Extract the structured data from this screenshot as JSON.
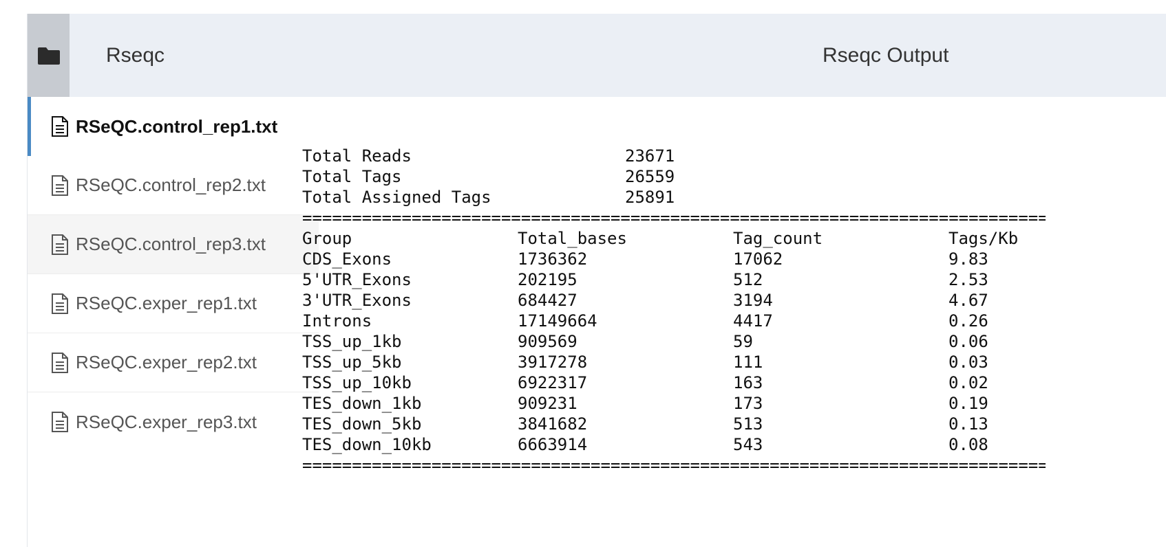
{
  "header": {
    "title": "Rseqc",
    "output_title": "Rseqc Output"
  },
  "files": [
    {
      "name": "RSeQC.control_rep1.txt"
    },
    {
      "name": "RSeQC.control_rep2.txt"
    },
    {
      "name": "RSeQC.control_rep3.txt"
    },
    {
      "name": "RSeQC.exper_rep1.txt"
    },
    {
      "name": "RSeQC.exper_rep2.txt"
    },
    {
      "name": "RSeQC.exper_rep3.txt"
    }
  ],
  "colors": {
    "accent": "#4a8ac4",
    "header_bg": "#ebeff5",
    "folder_bg": "#c7cbd1"
  },
  "output": {
    "summary": [
      {
        "label": "Total Reads",
        "value": "23671"
      },
      {
        "label": "Total Tags",
        "value": "26559"
      },
      {
        "label": "Total Assigned Tags",
        "value": "25891"
      }
    ],
    "separator": "==================================================================================",
    "columns": [
      "Group",
      "Total_bases",
      "Tag_count",
      "Tags/Kb"
    ],
    "rows": [
      [
        "CDS_Exons",
        "1736362",
        "17062",
        "9.83"
      ],
      [
        "5'UTR_Exons",
        "202195",
        "512",
        "2.53"
      ],
      [
        "3'UTR_Exons",
        "684427",
        "3194",
        "4.67"
      ],
      [
        "Introns",
        "17149664",
        "4417",
        "0.26"
      ],
      [
        "TSS_up_1kb",
        "909569",
        "59",
        "0.06"
      ],
      [
        "TSS_up_5kb",
        "3917278",
        "111",
        "0.03"
      ],
      [
        "TSS_up_10kb",
        "6922317",
        "163",
        "0.02"
      ],
      [
        "TES_down_1kb",
        "909231",
        "173",
        "0.19"
      ],
      [
        "TES_down_5kb",
        "3841682",
        "513",
        "0.13"
      ],
      [
        "TES_down_10kb",
        "6663914",
        "543",
        "0.08"
      ]
    ]
  }
}
